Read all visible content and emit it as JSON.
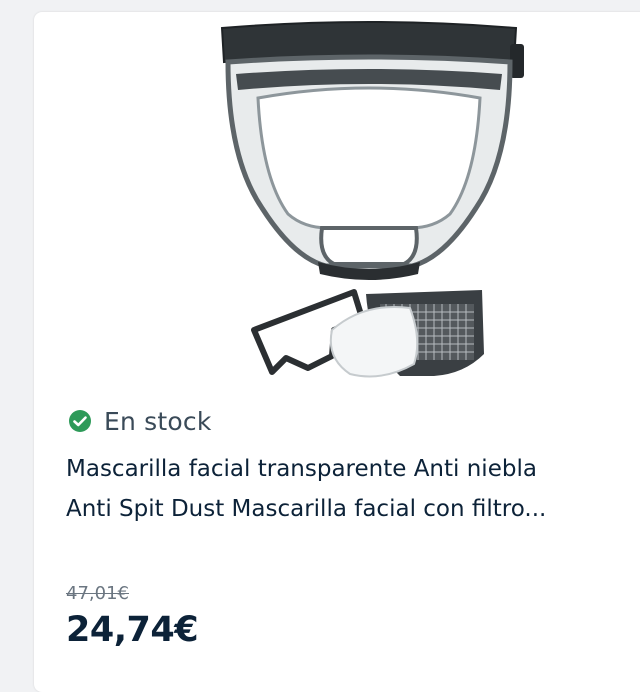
{
  "product": {
    "image_alt": "Mascarilla facial transparente con filtros",
    "stock_icon": "check-circle-icon",
    "stock_label": "En stock",
    "title_line1": "Mascarilla facial transparente Anti niebla",
    "title_line2": "Anti Spit Dust Mascarilla facial con filtro...",
    "old_price": "47,01€",
    "price": "24,74€"
  },
  "colors": {
    "stock_green": "#2e9a59",
    "price_text": "#0c2238",
    "old_price_text": "#6b7681"
  }
}
